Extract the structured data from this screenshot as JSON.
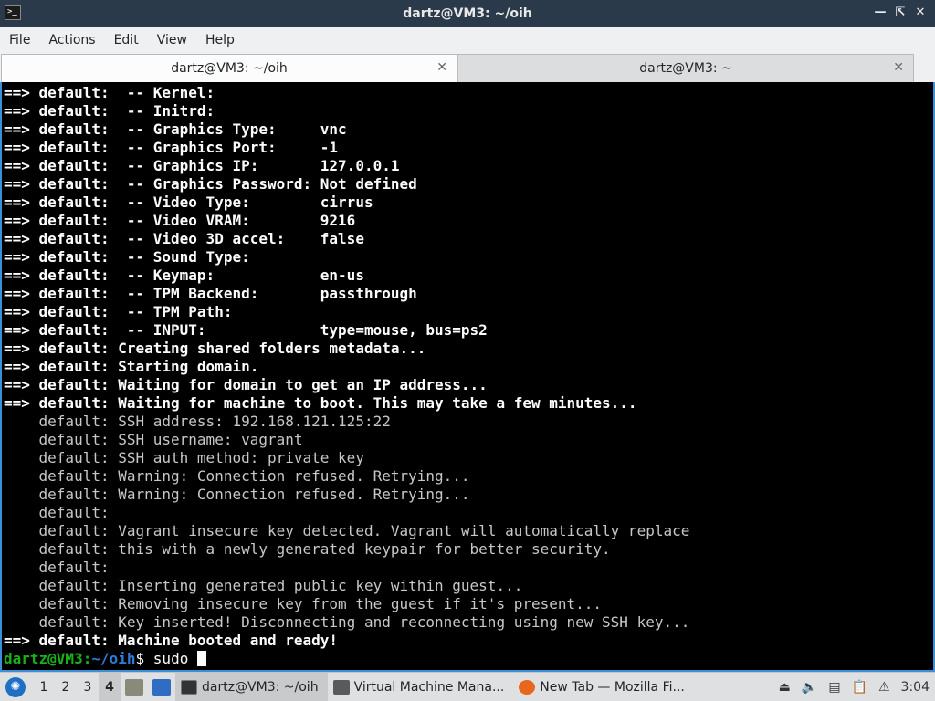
{
  "window": {
    "title": "dartz@VM3: ~/oih",
    "icon": "terminal-icon",
    "buttons": [
      "minimize-icon",
      "maximize-icon",
      "close-icon"
    ]
  },
  "menu": [
    "File",
    "Actions",
    "Edit",
    "View",
    "Help"
  ],
  "tabs": [
    {
      "label": "dartz@VM3: ~/oih",
      "active": true
    },
    {
      "label": "dartz@VM3: ~",
      "active": false
    }
  ],
  "terminal": {
    "lines": [
      {
        "text": "==> default:  -- Kernel:",
        "style": "b"
      },
      {
        "text": "==> default:  -- Initrd:",
        "style": "b"
      },
      {
        "text": "==> default:  -- Graphics Type:     vnc",
        "style": "b"
      },
      {
        "text": "==> default:  -- Graphics Port:     -1",
        "style": "b"
      },
      {
        "text": "==> default:  -- Graphics IP:       127.0.0.1",
        "style": "b"
      },
      {
        "text": "==> default:  -- Graphics Password: Not defined",
        "style": "b"
      },
      {
        "text": "==> default:  -- Video Type:        cirrus",
        "style": "b"
      },
      {
        "text": "==> default:  -- Video VRAM:        9216",
        "style": "b"
      },
      {
        "text": "==> default:  -- Video 3D accel:    false",
        "style": "b"
      },
      {
        "text": "==> default:  -- Sound Type:",
        "style": "b"
      },
      {
        "text": "==> default:  -- Keymap:            en-us",
        "style": "b"
      },
      {
        "text": "==> default:  -- TPM Backend:       passthrough",
        "style": "b"
      },
      {
        "text": "==> default:  -- TPM Path:",
        "style": "b"
      },
      {
        "text": "==> default:  -- INPUT:             type=mouse, bus=ps2",
        "style": "b"
      },
      {
        "text": "==> default: Creating shared folders metadata...",
        "style": "b"
      },
      {
        "text": "==> default: Starting domain.",
        "style": "b"
      },
      {
        "text": "==> default: Waiting for domain to get an IP address...",
        "style": "b"
      },
      {
        "text": "==> default: Waiting for machine to boot. This may take a few minutes...",
        "style": "b"
      },
      {
        "text": "    default: SSH address: 192.168.121.125:22",
        "style": "dim"
      },
      {
        "text": "    default: SSH username: vagrant",
        "style": "dim"
      },
      {
        "text": "    default: SSH auth method: private key",
        "style": "dim"
      },
      {
        "text": "    default: Warning: Connection refused. Retrying...",
        "style": "dim"
      },
      {
        "text": "    default: Warning: Connection refused. Retrying...",
        "style": "dim"
      },
      {
        "text": "    default:",
        "style": "dim"
      },
      {
        "text": "    default: Vagrant insecure key detected. Vagrant will automatically replace",
        "style": "dim"
      },
      {
        "text": "    default: this with a newly generated keypair for better security.",
        "style": "dim"
      },
      {
        "text": "    default:",
        "style": "dim"
      },
      {
        "text": "    default: Inserting generated public key within guest...",
        "style": "dim"
      },
      {
        "text": "    default: Removing insecure key from the guest if it's present...",
        "style": "dim"
      },
      {
        "text": "    default: Key inserted! Disconnecting and reconnecting using new SSH key...",
        "style": "dim"
      },
      {
        "text": "==> default: Machine booted and ready!",
        "style": "b"
      }
    ],
    "prompt": {
      "user": "dartz@VM3",
      "sep": ":",
      "path": "~/oih",
      "symbol": "$",
      "command": "sudo"
    }
  },
  "taskbar": {
    "start_icon": "start-menu-icon",
    "workspaces": [
      "1",
      "2",
      "3",
      "4"
    ],
    "active_workspace": "4",
    "quicklaunch": [
      "file-manager-icon",
      "desktop-icon"
    ],
    "tasks": [
      {
        "label": "dartz@VM3: ~/oih",
        "icon": "terminal-icon",
        "active": true
      },
      {
        "label": "Virtual Machine Mana...",
        "icon": "virt-manager-icon",
        "active": false
      },
      {
        "label": "New Tab — Mozilla Fi...",
        "icon": "firefox-icon",
        "active": false
      }
    ],
    "tray": [
      "eject-icon",
      "volume-icon",
      "network-icon",
      "clipboard-icon",
      "notification-icon"
    ],
    "clock": "3:04"
  }
}
